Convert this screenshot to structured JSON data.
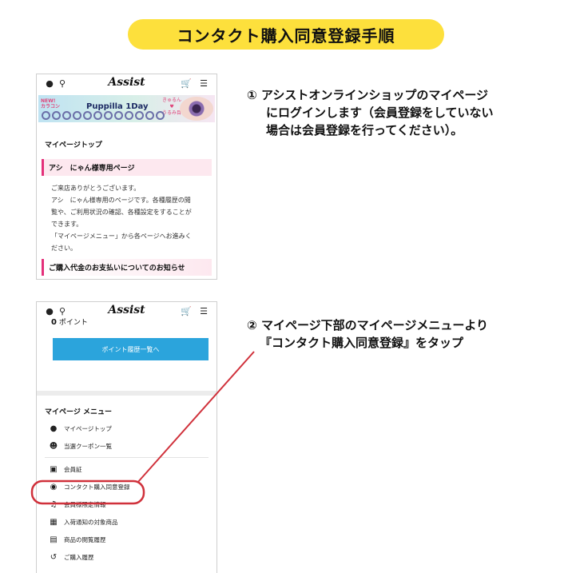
{
  "title": "コンタクト購入同意登録手順",
  "phone1": {
    "header_icons": [
      "person-icon",
      "search-icon",
      "cart-icon",
      "menu-icon"
    ],
    "logo": "Assist",
    "banner": {
      "new_text": "NEW!",
      "new_sub": "カラコン",
      "product": "Puppilla 1Day",
      "tag_line1": "きゅるん",
      "tag_line2": "♥",
      "tag_line3": "うるみ目"
    },
    "section_title": "マイページトップ",
    "user_bar": "アシ　にゃん様専用ページ",
    "body_lines": [
      "ご来店ありがとうございます。",
      "アシ　にゃん様専用のページです。各種履歴の閲",
      "覧や、ご利用状況の確認、各種設定をすることが",
      "できます。",
      "「マイページメニュー」から各ページへお進みく",
      "ださい。"
    ],
    "notice_bar": "ご購入代金のお支払いについてのお知らせ"
  },
  "phone2": {
    "logo": "Assist",
    "points_value": "0",
    "points_unit": "ポイント",
    "points_button": "ポイント履歴一覧へ",
    "menu_title": "マイページ メニュー",
    "menu_group1": [
      {
        "icon": "person-icon",
        "label": "マイページトップ"
      },
      {
        "icon": "coupon-person-icon",
        "label": "当選クーポン一覧"
      }
    ],
    "menu_group2": [
      {
        "icon": "id-card-icon",
        "label": "会員証"
      },
      {
        "icon": "eye-icon",
        "label": "コンタクト購入同意登録"
      },
      {
        "icon": "music-note-icon",
        "label": "会員様限定情報"
      },
      {
        "icon": "cubes-icon",
        "label": "入荷通知の対象商品"
      },
      {
        "icon": "clipboard-icon",
        "label": "商品の閲覧履歴"
      },
      {
        "icon": "history-icon",
        "label": "ご購入履歴"
      }
    ]
  },
  "steps": [
    {
      "number": "①",
      "lines": [
        "アシストオンラインショップのマイページ",
        "にログインします（会員登録をしていない",
        "場合は会員登録を行ってください）。"
      ]
    },
    {
      "number": "②",
      "lines": [
        "マイページ下部のマイページメニューより",
        "『コンタクト購入同意登録』をタップ"
      ]
    }
  ],
  "colors": {
    "title_bg": "#fde03c",
    "pink_accent": "#e4307a",
    "highlight_red": "#d0313b",
    "button_blue": "#2ba4dc"
  }
}
